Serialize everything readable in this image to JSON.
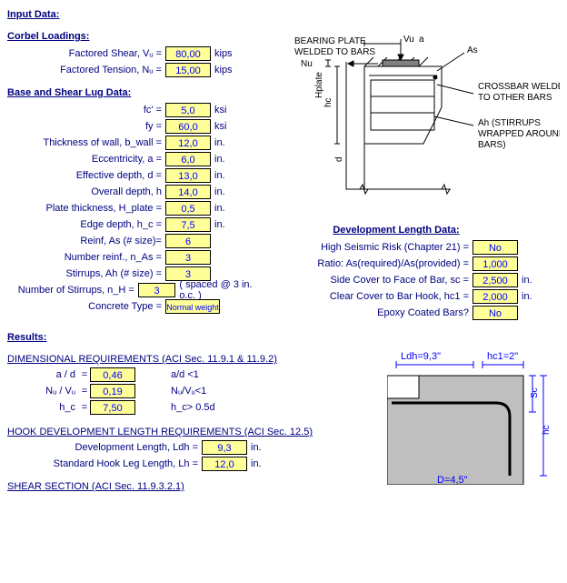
{
  "sections": {
    "input_data": "Input Data:",
    "corbel_loadings": "Corbel Loadings:",
    "base_shear": "Base and Shear Lug Data:",
    "dev_length": "Development Length Data:",
    "results": "Results:",
    "dim_req": "DIMENSIONAL REQUIREMENTS (ACI Sec. 11.9.1 & 11.9.2)",
    "hook_dev": "HOOK DEVELOPMENT LENGTH REQUIREMENTS (ACI Sec. 12.5)",
    "shear_section": "SHEAR SECTION (ACI Sec. 11.9.3.2.1)"
  },
  "loadings": {
    "vu_label": "Factored Shear, Vᵤ =",
    "vu": "80,00",
    "vu_unit": "kips",
    "nu_label": "Factored Tension, Nᵤ =",
    "nu": "15,00",
    "nu_unit": "kips"
  },
  "base": {
    "fc_label": "fc' =",
    "fc": "5,0",
    "fc_unit": "ksi",
    "fy_label": "fy =",
    "fy": "60,0",
    "fy_unit": "ksi",
    "bwall_label": "Thickness of wall, b_wall =",
    "bwall": "12,0",
    "bwall_unit": "in.",
    "ecc_label": "Eccentricity, a =",
    "ecc": "6,0",
    "ecc_unit": "in.",
    "d_label": "Effective depth, d =",
    "d": "13,0",
    "d_unit": "in.",
    "h_label": "Overall depth, h",
    "h": "14,0",
    "h_unit": "in.",
    "hplate_label": "Plate thickness, H_plate =",
    "hplate": "0,5",
    "hplate_unit": "in.",
    "hc_label": "Edge depth, h_c =",
    "hc": "7,5",
    "hc_unit": "in.",
    "reinf_label": "Reinf, As  (# size)=",
    "reinf": "6",
    "nas_label": "Number reinf., n_As =",
    "nas": "3",
    "stirrups_label": "Stirrups, Ah (# size) =",
    "stirrups": "3",
    "nh_label": "Number of Stirrups, n_H =",
    "nh": "3",
    "nh_note": "( spaced @ 3 in. o.c. )",
    "ctype_label": "Concrete Type =",
    "ctype": "Normal weight"
  },
  "dev": {
    "seismic_label": "High Seismic Risk (Chapter 21) =",
    "seismic": "No",
    "ratio_label": "Ratio: As(required)/As(provided) =",
    "ratio": "1,000",
    "sc_label": "Side Cover to Face of Bar, sc =",
    "sc": "2,500",
    "sc_unit": "in.",
    "hc1_label": "Clear Cover to Bar Hook, hc1 =",
    "hc1": "2,000",
    "hc1_unit": "in.",
    "epoxy_label": "Epoxy Coated Bars?",
    "epoxy": "No"
  },
  "results": {
    "ad_label": "a / d",
    "ad": "0,46",
    "ad_check": "a/d <1",
    "nuvu_label": "Nᵤ / Vᵤ",
    "nuvu": "0,19",
    "nuvu_check": "Nᵤ/Vᵤ<1",
    "rhc_label": "h_c",
    "rhc": "7,50",
    "rhc_check": "h_c> 0.5d",
    "ldh_label": "Development Length, Ldh =",
    "ldh": "9,3",
    "ldh_unit": "in.",
    "lh_label": "Standard Hook Leg Length, Lh =",
    "lh": "12,0",
    "lh_unit": "in."
  },
  "diagram_top": {
    "bearing": "BEARING PLATE",
    "welded": "WELDED TO BARS",
    "nu": "Nu",
    "vu": "Vu",
    "a": "a",
    "as": "As",
    "hc": "hc",
    "hplate": "Hplate",
    "d": "d",
    "crossbar1": "CROSSBAR WELDED",
    "crossbar2": "TO OTHER BARS",
    "ah1": "Ah (STIRRUPS",
    "ah2": "WRAPPED AROUND",
    "ah3": "BARS)"
  },
  "diagram_bottom": {
    "ldh": "Ldh=9,3\"",
    "hc1": "hc1=2\"",
    "sc": "Sc",
    "hc": "hc",
    "d_dim": "D=4,5\""
  }
}
